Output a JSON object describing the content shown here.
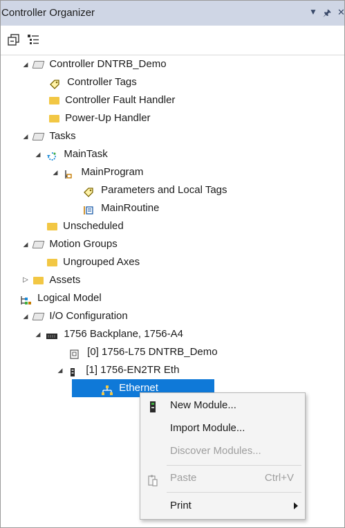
{
  "panel": {
    "title": "Controller Organizer",
    "pin_glyph": "▾",
    "dock_glyph": "⊣",
    "close_glyph": "✕"
  },
  "tree": {
    "controller": "Controller DNTRB_Demo",
    "controller_tags": "Controller Tags",
    "fault_handler": "Controller Fault Handler",
    "powerup_handler": "Power-Up Handler",
    "tasks": "Tasks",
    "main_task": "MainTask",
    "main_program": "MainProgram",
    "params_tags": "Parameters and Local Tags",
    "main_routine": "MainRoutine",
    "unscheduled": "Unscheduled",
    "motion_groups": "Motion Groups",
    "ungrouped_axes": "Ungrouped Axes",
    "assets": "Assets",
    "logical_model": "Logical Model",
    "io_config": "I/O Configuration",
    "backplane": "1756 Backplane, 1756-A4",
    "slot0": "[0] 1756-L75 DNTRB_Demo",
    "slot1": "[1] 1756-EN2TR Eth",
    "ethernet": "Ethernet"
  },
  "context_menu": {
    "new_module": "New Module...",
    "import_module": "Import Module...",
    "discover_modules": "Discover Modules...",
    "paste": "Paste",
    "paste_shortcut": "Ctrl+V",
    "print": "Print"
  },
  "colors": {
    "selection": "#0f79d8",
    "folder": "#f2c744",
    "titlebar": "#cfd6e5"
  }
}
